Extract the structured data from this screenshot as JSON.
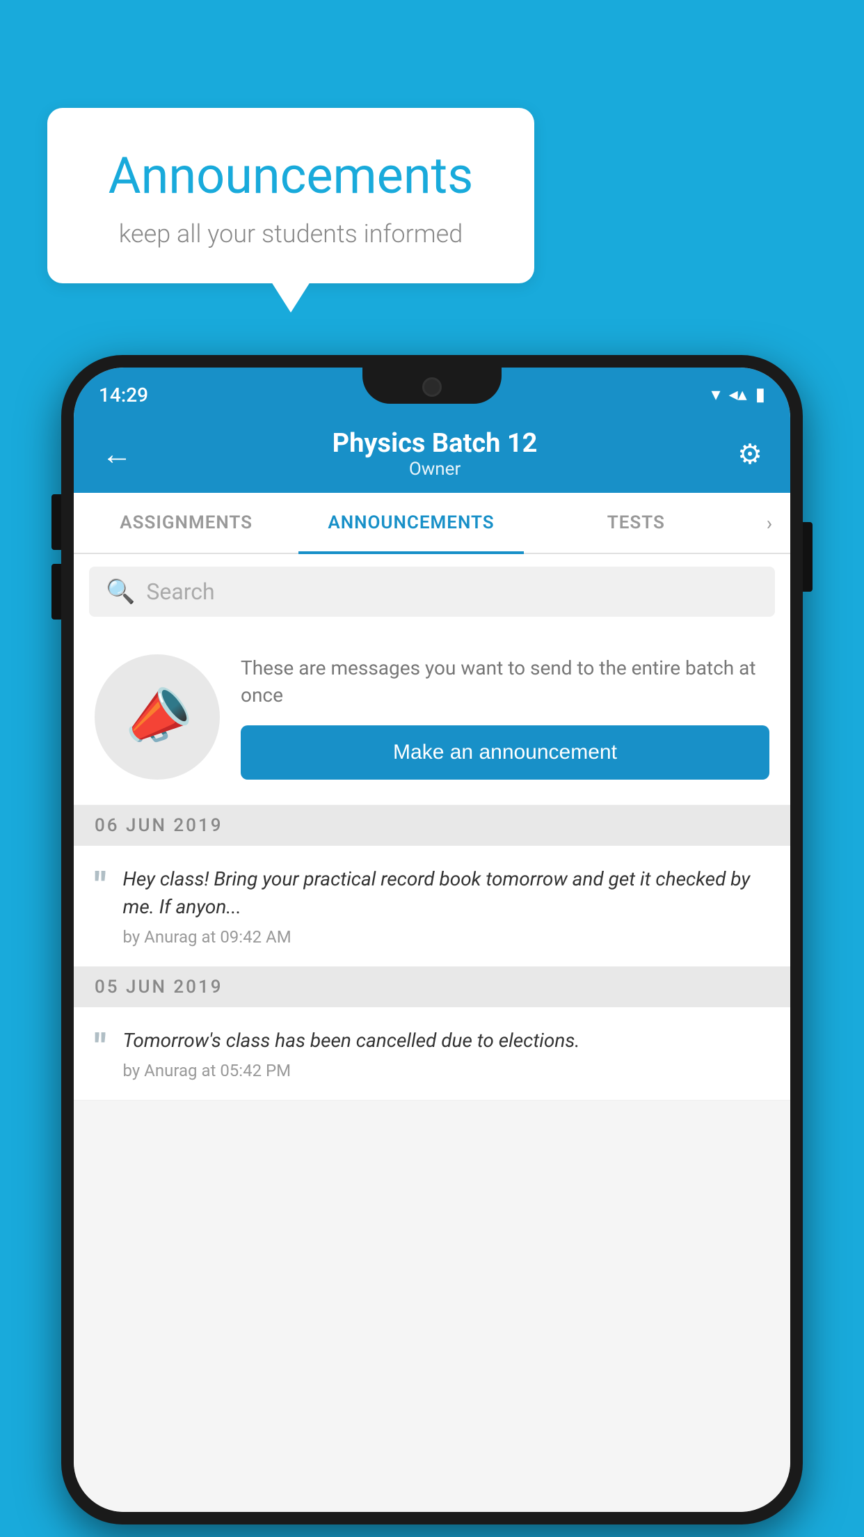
{
  "background_color": "#19AADB",
  "speech_bubble": {
    "title": "Announcements",
    "subtitle": "keep all your students informed"
  },
  "phone": {
    "status_bar": {
      "time": "14:29",
      "wifi": "▼",
      "signal": "▲",
      "battery": "▮"
    },
    "app_bar": {
      "title": "Physics Batch 12",
      "subtitle": "Owner",
      "back_label": "←",
      "settings_label": "⚙"
    },
    "tabs": [
      {
        "label": "ASSIGNMENTS",
        "active": false
      },
      {
        "label": "ANNOUNCEMENTS",
        "active": true
      },
      {
        "label": "TESTS",
        "active": false
      }
    ],
    "tabs_more": "›",
    "search": {
      "placeholder": "Search"
    },
    "promo": {
      "description": "These are messages you want to send to the entire batch at once",
      "button_label": "Make an announcement"
    },
    "announcements": [
      {
        "date": "06  JUN  2019",
        "text": "Hey class! Bring your practical record book tomorrow and get it checked by me. If anyon...",
        "meta": "by Anurag at 09:42 AM"
      },
      {
        "date": "05  JUN  2019",
        "text": "Tomorrow's class has been cancelled due to elections.",
        "meta": "by Anurag at 05:42 PM"
      }
    ]
  }
}
